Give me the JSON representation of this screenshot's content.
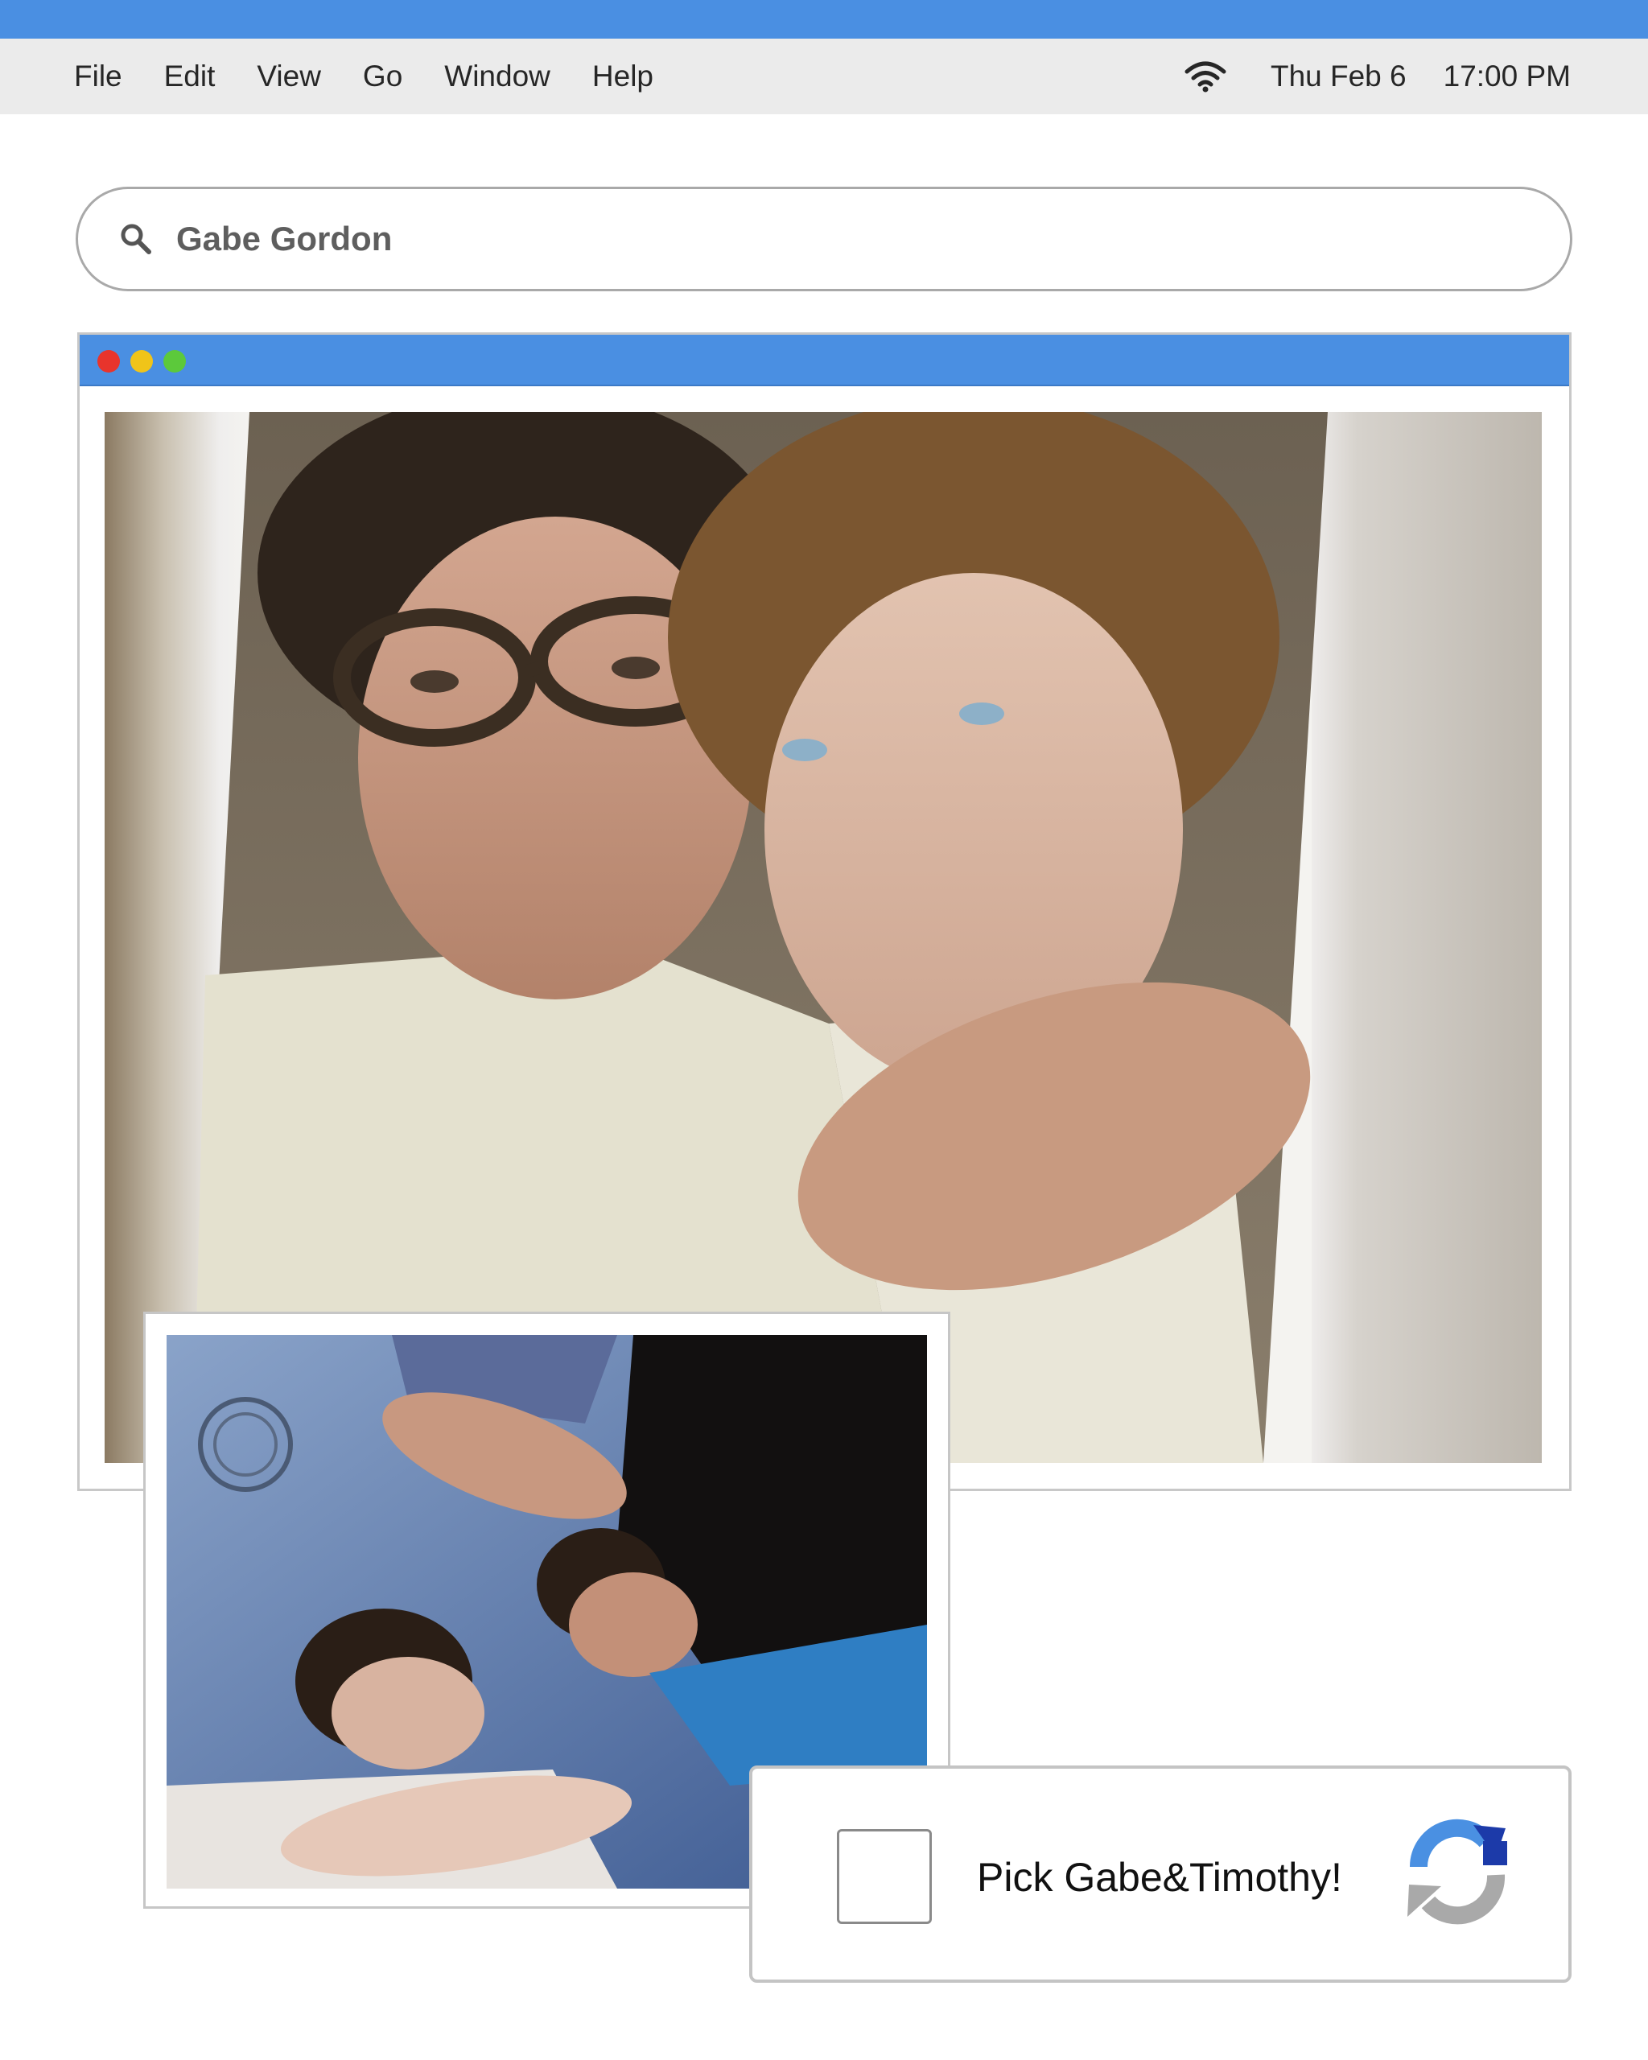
{
  "menubar": {
    "items": [
      "File",
      "Edit",
      "View",
      "Go",
      "Window",
      "Help"
    ],
    "date": "Thu Feb 6",
    "time": "17:00 PM",
    "icons": {
      "wifi": "wifi-icon"
    }
  },
  "search": {
    "query": "Gabe Gordon",
    "icon": "search-icon"
  },
  "window": {
    "controls": [
      "close",
      "minimize",
      "zoom"
    ],
    "colors": {
      "titlebar": "#4a8fe2",
      "close": "#e8342c",
      "minimize": "#f0c419",
      "zoom": "#5cc93b"
    }
  },
  "captcha": {
    "label": "Pick Gabe&Timothy!",
    "icon": "recaptcha-icon"
  },
  "colors": {
    "accent": "#4a8fe2",
    "menubar_bg": "#ebebeb"
  }
}
